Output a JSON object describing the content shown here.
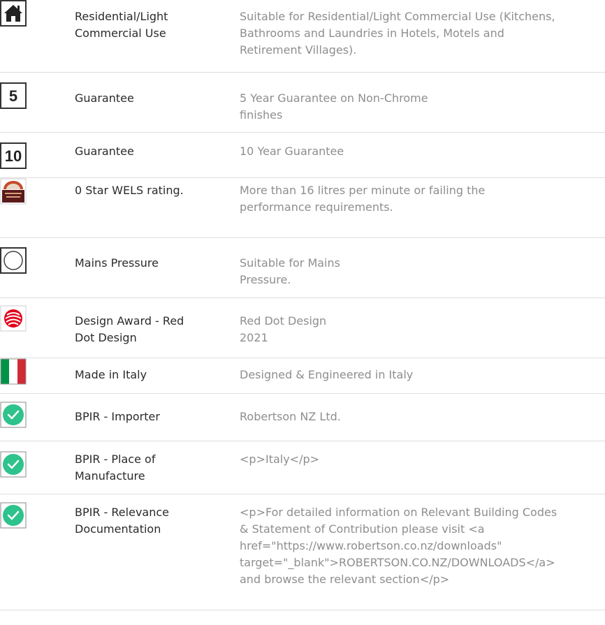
{
  "features": [
    {
      "icon": "house-icon",
      "label": "Residential/Light\nCommercial Use",
      "description": "Suitable for Residential/Light Commercial Use (Kitchens,\nBathrooms and Laundries in Hotels, Motels and\nRetirement Villages)."
    },
    {
      "icon": "five-year-guarantee-icon",
      "icon_text": "5",
      "label": "Guarantee",
      "description": "5 Year Guarantee on Non-Chrome\nfinishes"
    },
    {
      "icon": "ten-year-guarantee-icon",
      "icon_text": "10",
      "label": "Guarantee",
      "description": "10 Year Guarantee"
    },
    {
      "icon": "wels-rating-icon",
      "label": "0 Star WELS rating.",
      "description": "More than 16 litres per minute or failing the\nperformance requirements."
    },
    {
      "icon": "mains-pressure-icon",
      "label": "Mains Pressure",
      "description": "Suitable for Mains\nPressure."
    },
    {
      "icon": "red-dot-award-icon",
      "label": "Design Award - Red\nDot Design",
      "description": "Red Dot Design\n2021"
    },
    {
      "icon": "italy-flag-icon",
      "label": "Made in Italy",
      "description": "Designed & Engineered in Italy"
    },
    {
      "icon": "checkmark-icon",
      "label": "BPIR - Importer",
      "description": "Robertson NZ Ltd."
    },
    {
      "icon": "checkmark-icon",
      "label": "BPIR - Place of\nManufacture",
      "description": "<p>Italy</p>"
    },
    {
      "icon": "checkmark-icon",
      "label": "BPIR - Relevance\nDocumentation",
      "description": "<p>For detailed information on Relevant Building Codes\n& Statement of Contribution please visit <a\nhref=\"https://www.robertson.co.nz/downloads\"\ntarget=\"_blank\">ROBERTSON.CO.NZ/DOWNLOADS</a>\nand browse the relevant section</p>"
    }
  ],
  "colors": {
    "label": "#2b2b2b",
    "description": "#8e8e8e",
    "divider": "#dedede",
    "check_green": "#2ec28c",
    "red_dot": "#e2001a",
    "italy_green": "#009246",
    "italy_red": "#ce2b37"
  }
}
